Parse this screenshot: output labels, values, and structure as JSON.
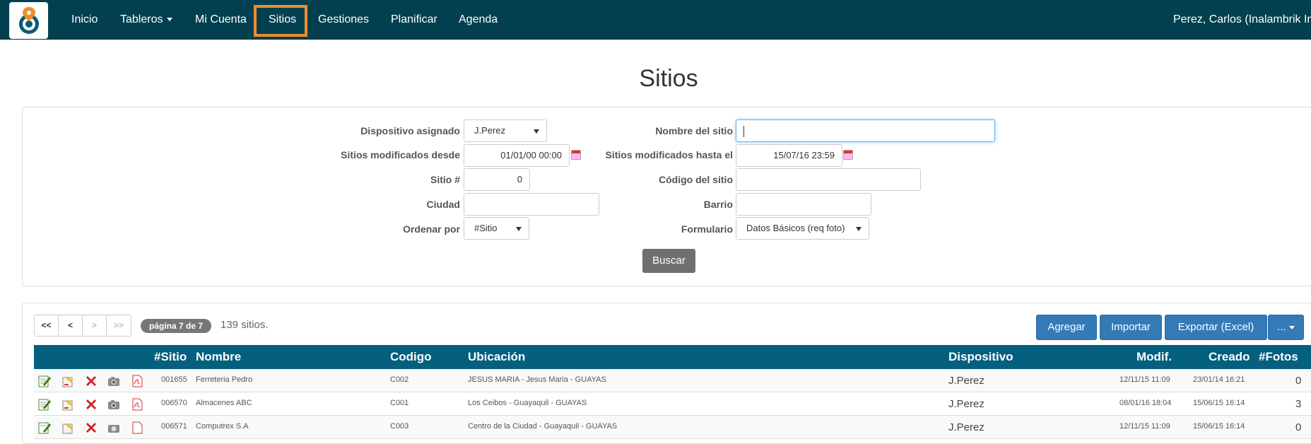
{
  "nav": {
    "items": [
      "Inicio",
      "Tableros",
      "Mi Cuenta",
      "Sitios",
      "Gestiones",
      "Planificar",
      "Agenda"
    ],
    "user": "Perez, Carlos (Inalambrik Inf"
  },
  "page": {
    "title": "Sitios"
  },
  "filters": {
    "dispositivo_label": "Dispositivo asignado",
    "dispositivo_value": "J.Perez",
    "nombre_label": "Nombre del sitio",
    "nombre_value": "",
    "desde_label": "Sitios modificados desde",
    "desde_value": "01/01/00 00:00",
    "hasta_label": "Sitios modificados hasta el",
    "hasta_value": "15/07/16 23:59",
    "sitio_label": "Sitio #",
    "sitio_value": "0",
    "codigo_label": "Código del sitio",
    "codigo_value": "",
    "ciudad_label": "Ciudad",
    "ciudad_value": "",
    "barrio_label": "Barrio",
    "barrio_value": "",
    "ordenar_label": "Ordenar por",
    "ordenar_value": "#Sitio",
    "formulario_label": "Formulario",
    "formulario_value": "Datos Básicos (req foto)",
    "buscar_label": "Buscar"
  },
  "results": {
    "pager": [
      "<<",
      "<",
      ">",
      ">>"
    ],
    "page_badge": "página 7 de 7",
    "count": "139 sitios.",
    "actions": [
      "Agregar",
      "Importar",
      "Exportar (Excel)",
      "..."
    ]
  },
  "table": {
    "headers": [
      "#Sitio",
      "Nombre",
      "Codigo",
      "Ubicación",
      "Dispositivo",
      "Modif.",
      "Creado",
      "#Fotos"
    ],
    "rows": [
      {
        "sitio": "001655",
        "nombre": "Ferreteria Pedro",
        "codigo": "C002",
        "ubicacion": "JESUS MARIA - Jesus Maria - GUAYAS",
        "dispositivo": "J.Perez",
        "modif": "12/11/15 11:09",
        "creado": "23/01/14 16:21",
        "fotos": "0"
      },
      {
        "sitio": "006570",
        "nombre": "Almacenes ABC",
        "codigo": "C001",
        "ubicacion": "Los Ceibos - Guayaquil - GUAYAS",
        "dispositivo": "J.Perez",
        "modif": "08/01/16 18:04",
        "creado": "15/06/15 16:14",
        "fotos": "3"
      },
      {
        "sitio": "006571",
        "nombre": "Computrex S.A",
        "codigo": "C003",
        "ubicacion": "Centro de la Ciudad - Guayaquil - GUAYAS",
        "dispositivo": "J.Perez",
        "modif": "12/11/15 11:09",
        "creado": "15/06/15 16:14",
        "fotos": "0"
      }
    ]
  },
  "colors": {
    "navbar": "#02404f",
    "highlight": "#f08c2c",
    "table_header": "#055f7e",
    "primary": "#337ab7"
  }
}
